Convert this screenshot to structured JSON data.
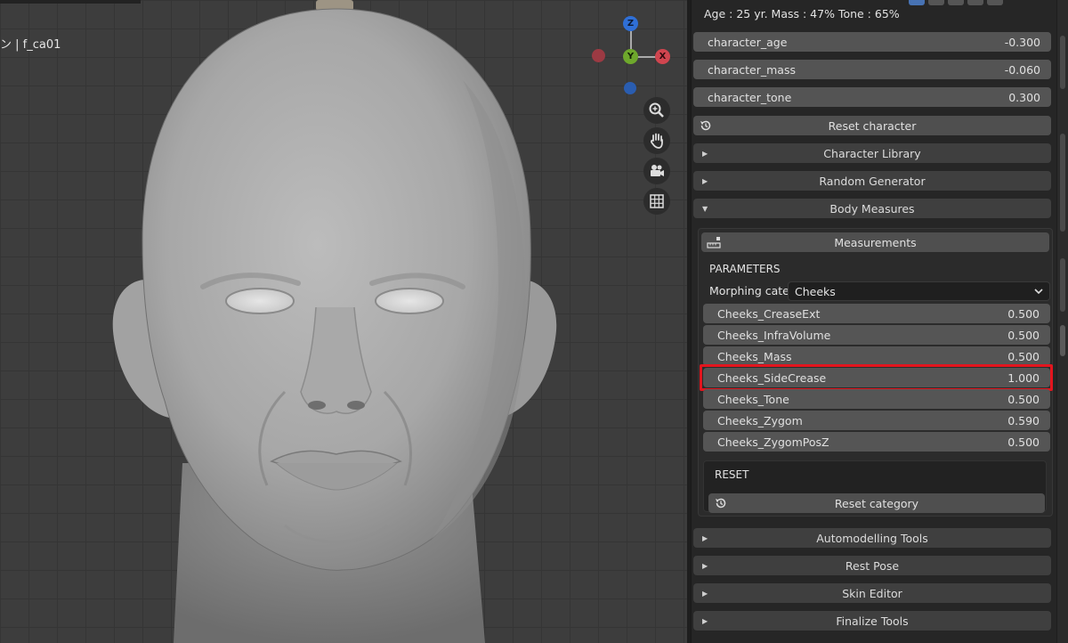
{
  "viewport": {
    "object_label": "ン | f_ca01",
    "gizmo": {
      "z": "Z",
      "y": "Y",
      "x": "X"
    },
    "nav_icons": [
      "zoom-icon",
      "hand-pan-icon",
      "camera-icon",
      "grid-icon"
    ]
  },
  "panel": {
    "info": "Age : 25 yr.  Mass : 47%  Tone : 65%",
    "character_props": [
      {
        "name": "character_age",
        "value": "-0.300"
      },
      {
        "name": "character_mass",
        "value": "-0.060"
      },
      {
        "name": "character_tone",
        "value": "0.300"
      }
    ],
    "reset_character": "Reset character",
    "sections_top": [
      {
        "label": "Character Library",
        "state": "collapsed"
      },
      {
        "label": "Random Generator",
        "state": "collapsed"
      },
      {
        "label": "Body Measures",
        "state": "expanded"
      }
    ],
    "measurements_button": "Measurements",
    "parameters_heading": "PARAMETERS",
    "morphing_label": "Morphing cate..",
    "morphing_value": "Cheeks",
    "params": [
      {
        "name": "Cheeks_CreaseExt",
        "value": "0.500"
      },
      {
        "name": "Cheeks_InfraVolume",
        "value": "0.500"
      },
      {
        "name": "Cheeks_Mass",
        "value": "0.500"
      },
      {
        "name": "Cheeks_SideCrease",
        "value": "1.000",
        "highlighted": true
      },
      {
        "name": "Cheeks_Tone",
        "value": "0.500"
      },
      {
        "name": "Cheeks_Zygom",
        "value": "0.590"
      },
      {
        "name": "Cheeks_ZygomPosZ",
        "value": "0.500"
      }
    ],
    "reset_heading": "RESET",
    "reset_category": "Reset category",
    "sections_bottom": [
      {
        "label": "Automodelling Tools",
        "state": "collapsed"
      },
      {
        "label": "Rest Pose",
        "state": "collapsed"
      },
      {
        "label": "Skin Editor",
        "state": "collapsed"
      },
      {
        "label": "Finalize Tools",
        "state": "collapsed"
      }
    ],
    "colors": {
      "highlight": "#e3151e",
      "row": "#545454",
      "header": "#3f3f3f"
    }
  }
}
